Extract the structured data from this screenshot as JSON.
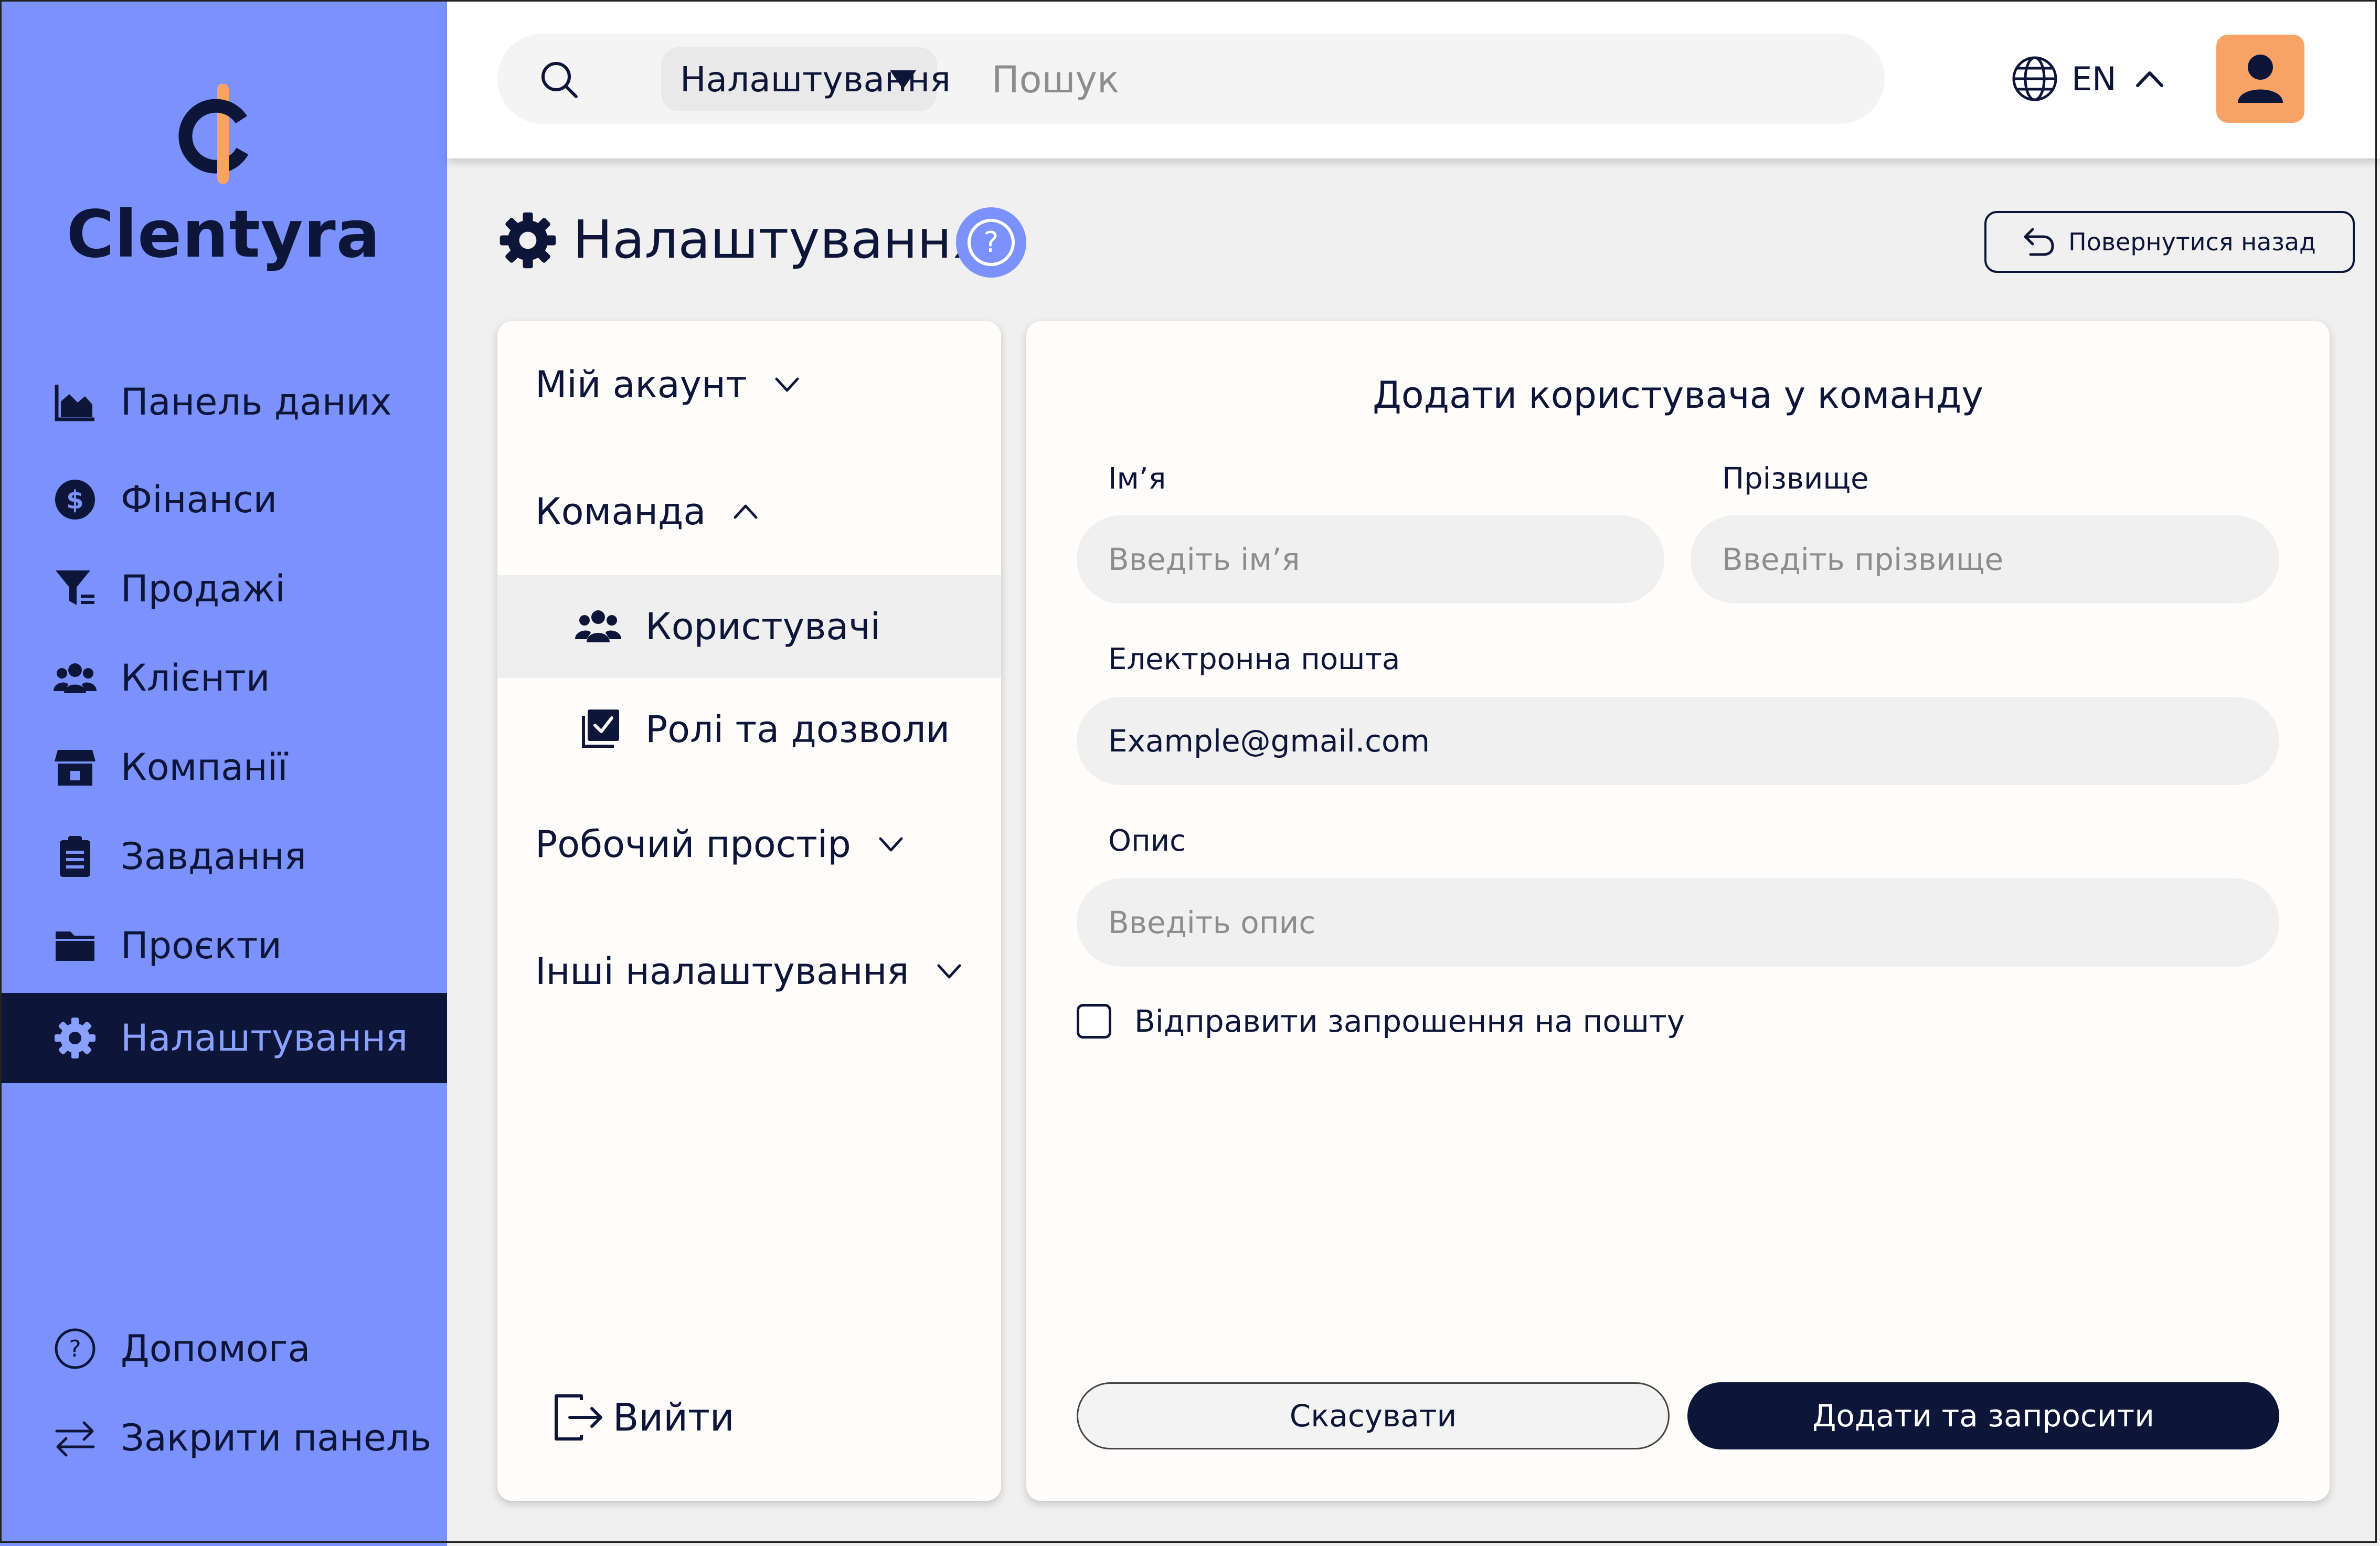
{
  "brand": {
    "name": "Clentyra"
  },
  "colors": {
    "sidebar": "#7b92fc",
    "navy": "#0d1638",
    "accent_orange": "#f7a366",
    "active_text": "#8aa0ff"
  },
  "sidebar": {
    "items": [
      {
        "label": "Панель даних",
        "icon": "chart-area-icon"
      },
      {
        "label": "Фінанси",
        "icon": "dollar-circle-icon"
      },
      {
        "label": "Продажі",
        "icon": "funnel-icon"
      },
      {
        "label": "Клієнти",
        "icon": "users-icon"
      },
      {
        "label": "Компанії",
        "icon": "store-icon"
      },
      {
        "label": "Завдання",
        "icon": "clipboard-icon"
      },
      {
        "label": "Проєкти",
        "icon": "folder-icon"
      },
      {
        "label": "Налаштування",
        "icon": "gear-icon",
        "active": true
      }
    ],
    "help_label": "Допомога",
    "collapse_label": "Закрити панель"
  },
  "header": {
    "search": {
      "scope": "Налаштування",
      "placeholder": "Пошук"
    },
    "language": "EN"
  },
  "page": {
    "title": "Налаштування",
    "back_label": "Повернутися назад"
  },
  "settings_menu": {
    "my_account": "Мій акаунт",
    "team": "Команда",
    "users": "Користувачі",
    "roles": "Ролі та дозволи",
    "workspace": "Робочий простір",
    "other": "Інші налаштування",
    "logout": "Вийти"
  },
  "form": {
    "title": "Додати користувача у команду",
    "first_name": {
      "label": "Ім’я",
      "placeholder": "Введіть ім’я",
      "value": ""
    },
    "last_name": {
      "label": "Прізвище",
      "placeholder": "Введіть прізвище",
      "value": ""
    },
    "email": {
      "label": "Електронна пошта",
      "value": "Example@gmail.com"
    },
    "description": {
      "label": "Опис",
      "placeholder": "Введіть опис",
      "value": ""
    },
    "send_invite": {
      "label": "Відправити запрошення на пошту",
      "checked": false
    },
    "cancel_label": "Скасувати",
    "submit_label": "Додати та запросити"
  }
}
